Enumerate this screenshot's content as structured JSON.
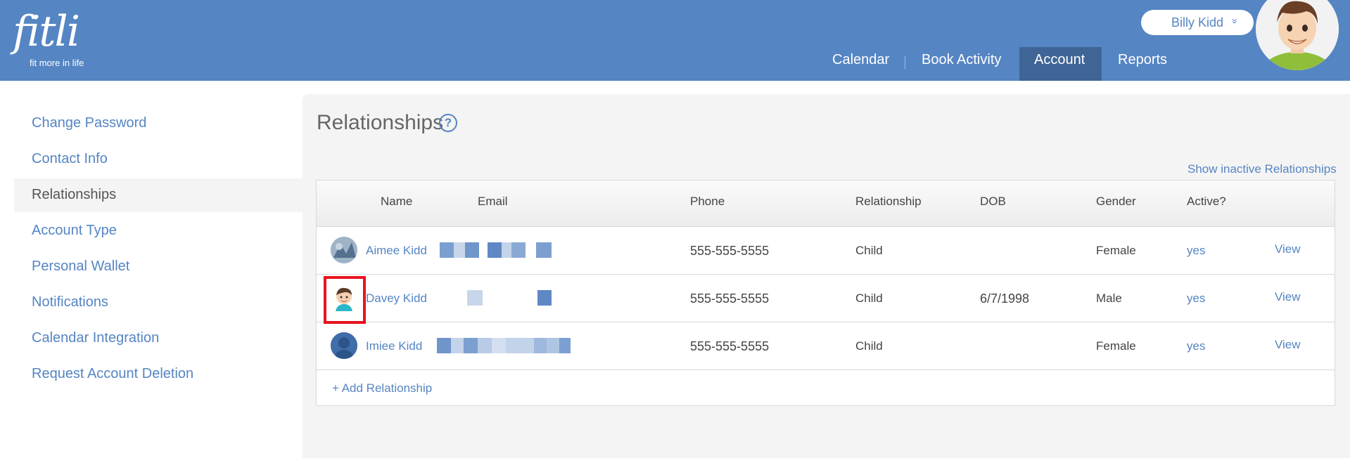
{
  "header": {
    "logo_word": "fitli",
    "logo_tagline": "fit more in life",
    "user_name": "Billy Kidd",
    "user_chevron": "»",
    "nav": [
      "Calendar",
      "Book Activity",
      "Account",
      "Reports"
    ],
    "nav_active": "Account"
  },
  "sidebar": {
    "items": [
      "Change Password",
      "Contact Info",
      "Relationships",
      "Account Type",
      "Personal Wallet",
      "Notifications",
      "Calendar Integration",
      "Request Account Deletion"
    ],
    "active": "Relationships"
  },
  "main": {
    "title": "Relationships",
    "help_icon": "?",
    "show_inactive": "Show inactive Relationships",
    "table": {
      "headers": [
        "Name",
        "Email",
        "Phone",
        "Relationship",
        "DOB",
        "Gender",
        "Active?"
      ],
      "rows": [
        {
          "name": "Aimee Kidd",
          "phone": "555-555-5555",
          "relationship": "Child",
          "dob": "",
          "gender": "Female",
          "active": "yes",
          "action": "View"
        },
        {
          "name": "Davey Kidd",
          "phone": "555-555-5555",
          "relationship": "Child",
          "dob": "6/7/1998",
          "gender": "Male",
          "active": "yes",
          "action": "View"
        },
        {
          "name": "Imiee Kidd",
          "phone": "555-555-5555",
          "relationship": "Child",
          "dob": "",
          "gender": "Female",
          "active": "yes",
          "action": "View"
        }
      ]
    },
    "add_relationship": "+ Add Relationship"
  },
  "colors": {
    "brand": "#5585c3",
    "nav_active": "#3f6597",
    "highlight": "#e8141e"
  }
}
